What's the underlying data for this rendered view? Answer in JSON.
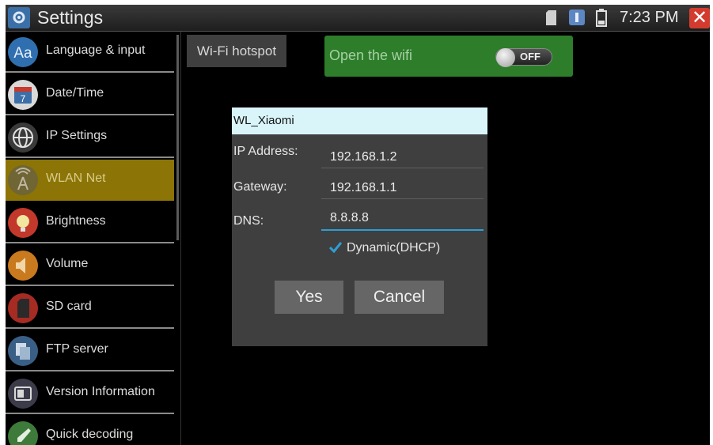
{
  "statusbar": {
    "title": "Settings",
    "time": "7:23 PM",
    "icons": [
      "settings-app-icon",
      "sd-card-icon",
      "notification-icon",
      "battery-icon",
      "close-icon"
    ]
  },
  "sidebar": {
    "items": [
      {
        "label": "Language & input",
        "icon": "language-icon"
      },
      {
        "label": "Date/Time",
        "icon": "calendar-icon"
      },
      {
        "label": "IP Settings",
        "icon": "globe-icon"
      },
      {
        "label": "WLAN Net",
        "icon": "wifi-tower-icon",
        "active": true
      },
      {
        "label": "Brightness",
        "icon": "brightness-icon"
      },
      {
        "label": "Volume",
        "icon": "speaker-icon"
      },
      {
        "label": "SD card",
        "icon": "sd-card-icon"
      },
      {
        "label": "FTP server",
        "icon": "ftp-icon"
      },
      {
        "label": "Version Information",
        "icon": "version-icon"
      },
      {
        "label": "Quick decoding",
        "icon": "rocket-icon"
      }
    ]
  },
  "main": {
    "tab_label": "Wi-Fi hotspot",
    "wifi_label": "Open the wifi",
    "wifi_toggle": "OFF"
  },
  "dialog": {
    "title": "WL_Xiaomi",
    "ip_label": "IP Address:",
    "ip_value": "192.168.1.2",
    "gateway_label": "Gateway:",
    "gateway_value": "192.168.1.1",
    "dns_label": "DNS:",
    "dns_value": "8.8.8.8",
    "dhcp_label": "Dynamic(DHCP)",
    "dhcp_checked": true,
    "yes_label": "Yes",
    "cancel_label": "Cancel"
  },
  "colors": {
    "active_item": "#8c7406",
    "wifi_panel": "#2d7d2b",
    "dialog_bg": "#3f3f3f",
    "dialog_title_bg": "#d9f5fa",
    "focus_line": "#2e9fd4",
    "close_button": "#d43b2f"
  }
}
